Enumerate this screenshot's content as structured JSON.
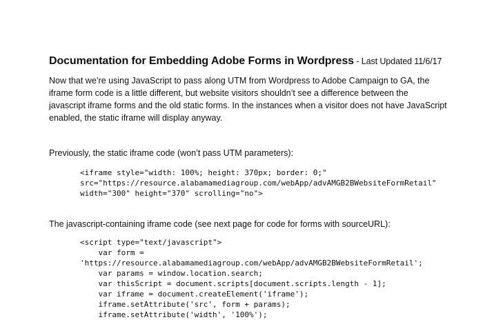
{
  "document": {
    "title": "Documentation for Embedding Adobe Forms in Wordpress",
    "updated": " - Last Updated 11/6/17",
    "intro_lines": [
      "Now that we’re using JavaScript to pass along UTM from Wordpress to Adobe Campaign to GA, the",
      "iframe form code is a little different, but website visitors shouldn’t see a difference between the",
      "javascript iframe forms and the old static forms. In the instances when a visitor does not have JavaScript",
      "enabled, the static iframe will display anyway."
    ],
    "static_label": "Previously, the static iframe code (won’t pass UTM parameters):",
    "static_code_lines": [
      "<iframe style=\"width: 100%; height: 370px; border: 0;\"",
      "src=\"https://resource.alabamamediagroup.com/webApp/advAMGB2BWebsiteFormRetail\"",
      "width=\"300\" height=\"370\" scrolling=\"no\">"
    ],
    "js_label": "The javascript-containing iframe code (see next page for code for forms with sourceURL):",
    "js_code_lines": [
      "<script type=\"text/javascript\">",
      "    var form =",
      "'https://resource.alabamamediagroup.com/webApp/advAMGB2BWebsiteFormRetail';",
      "    var params = window.location.search;",
      "    var thisScript = document.scripts[document.scripts.length - 1];",
      "    var iframe = document.createElement('iframe');",
      "    iframe.setAttribute('src', form + params);",
      "    iframe.setAttribute('width', '100%');"
    ]
  }
}
